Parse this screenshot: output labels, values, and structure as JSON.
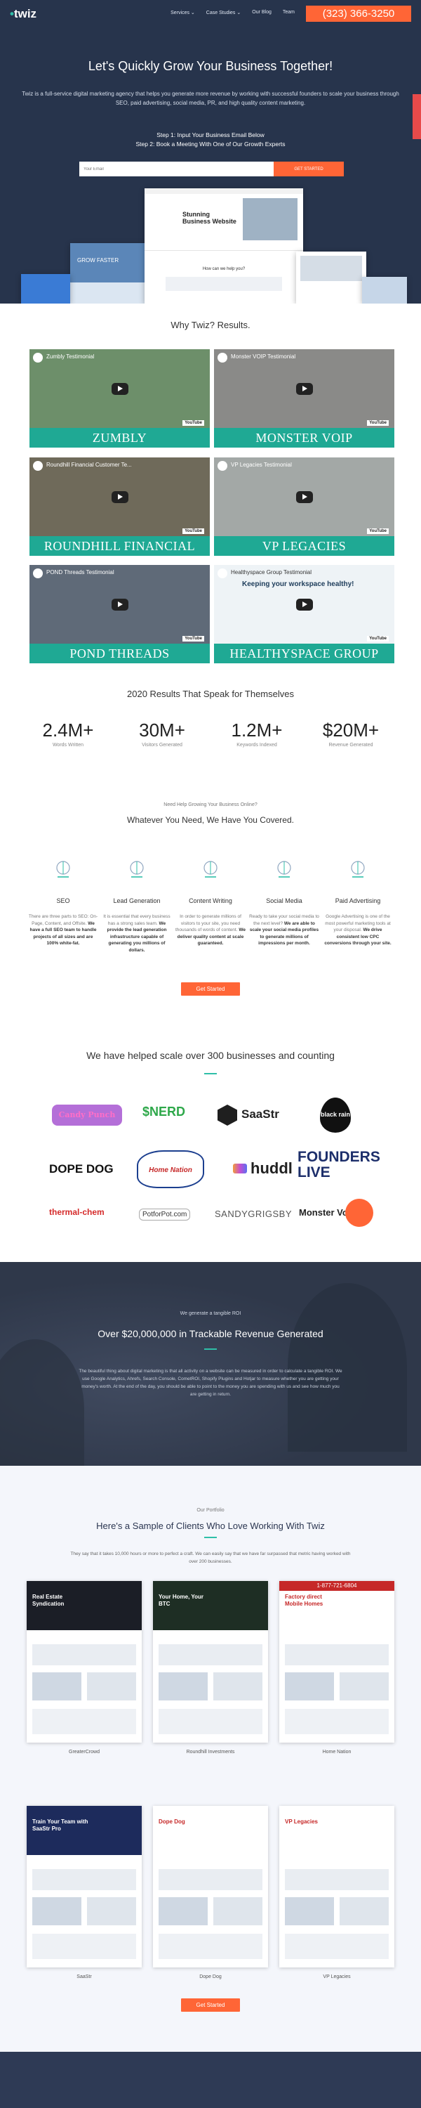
{
  "header": {
    "logo": "twiz",
    "nav": [
      "Services ⌄",
      "Case Studies ⌄",
      "Our Blog",
      "Team"
    ],
    "phone": "(323) 366-3250"
  },
  "hero": {
    "title": "Let's Quickly Grow Your Business Together!",
    "description": "Twiz is a full-service digital marketing agency that helps you generate more revenue by working with successful founders to scale your business through SEO, paid advertising, social media, PR, and high quality content marketing.",
    "step1": "Step 1: Input Your Business Email Below",
    "step2": "Step 2: Book a Meeting With One of Our Growth Experts",
    "email_placeholder": "Your Email",
    "button": "GET STARTED",
    "mock_headline": "Stunning Business Website",
    "mock_sub": "How can we help you?",
    "mock_left": "GROW FASTER"
  },
  "why": {
    "title": "Why Twiz? Results.",
    "videos": [
      {
        "title": "Zumbly Testimonial",
        "band": "ZUMBLY",
        "bg": "#6d8f6a"
      },
      {
        "title": "Monster VOIP Testimonial",
        "band": "MONSTER VOIP",
        "bg": "#8a8a88"
      },
      {
        "title": "Roundhill Financial Customer Te...",
        "band": "ROUNDHILL FINANCIAL",
        "bg": "#6f6a5a"
      },
      {
        "title": "VP Legacies Testimonial",
        "band": "VP LEGACIES",
        "bg": "#a3a8a6"
      },
      {
        "title": "POND Threads Testimonial",
        "band": "POND THREADS",
        "bg": "#5f6a78"
      },
      {
        "title": "Healthyspace Group Testimonial",
        "band": "HEALTHYSPACE GROUP",
        "bg": "#eef3f6"
      }
    ],
    "youtube": "YouTube",
    "healthy_banner": "Keeping your workspace healthy!"
  },
  "results": {
    "title": "2020 Results That Speak for Themselves",
    "stats": [
      {
        "num": "2.4M+",
        "label": "Words Written"
      },
      {
        "num": "30M+",
        "label": "Visitors Generated"
      },
      {
        "num": "1.2M+",
        "label": "Keywords Indexed"
      },
      {
        "num": "$20M+",
        "label": "Revenue Generated"
      }
    ]
  },
  "services": {
    "eyebrow": "Need Help Growing Your Business Online?",
    "title": "Whatever You Need, We Have You Covered.",
    "items": [
      {
        "name": "SEO",
        "desc": "There are three parts to SEO: On-Page, Content, and Offsite.",
        "bold": "We have a full SEO team to handle projects of all sizes and are 100% white-fat."
      },
      {
        "name": "Lead Generation",
        "desc": "It is essential that every business has a strong sales team.",
        "bold": "We provide the lead generation infrastructure capable of generating you millions of dollars."
      },
      {
        "name": "Content Writing",
        "desc": "In order to generate millions of visitors to your site, you need thousands of words of content.",
        "bold": "We deliver quality content at scale guaranteed."
      },
      {
        "name": "Social Media",
        "desc": "Ready to take your social media to the next level?",
        "bold": "We are able to scale your social media profiles to generate millions of impressions per month."
      },
      {
        "name": "Paid Advertising",
        "desc": "Google Advertising is one of the most powerful marketing tools at your disposal.",
        "bold": "We drive consistent low CPC conversions through your site."
      }
    ],
    "button": "Get Started"
  },
  "clients": {
    "title": "We have helped scale over 300 businesses and counting",
    "logos": [
      "Candy Punch",
      "$NERD",
      "SaaStr",
      "black rain",
      "DOPE DOG",
      "Home Nation",
      "huddl",
      "FOUNDERS LIVE",
      "thermal-chem",
      "PotforPot.com",
      "SANDYGRIGSBY",
      "Monster VoIP"
    ]
  },
  "revenue": {
    "eyebrow": "We generate a tangible ROI",
    "title": "Over $20,000,000 in Trackable Revenue Generated",
    "body": "The beautiful thing about digital marketing is that all activity on a website can be measured in order to calculate a tangible ROI. We use Google Analytics, Ahrefs, Search Console, CometROI, Shopify Plugins and Hotjar to measure whether you are getting your money's worth. At the end of the day, you should be able to point to the money you are spending with us and see how much you are getting in return."
  },
  "portfolio": {
    "eyebrow": "Our Portfolio",
    "title": "Here's a Sample of Clients Who Love Working With Twiz",
    "body": "They say that it takes 10,000 hours or more to perfect a craft. We can easily say that we have far surpassed that metric having worked with over 200 businesses.",
    "items": [
      {
        "caption": "GreaterCrowd",
        "hero": "Real Estate Syndication"
      },
      {
        "caption": "Roundhill Investments",
        "hero": "Your Home, Your BTC"
      },
      {
        "caption": "Home Nation",
        "hero": "Factory direct Mobile Homes"
      },
      {
        "caption": "SaaStr",
        "hero": "Train Your Team with SaaStr Pro"
      },
      {
        "caption": "Dope Dog",
        "hero": "Dope Dog"
      },
      {
        "caption": "VP Legacies",
        "hero": "VP Legacies"
      }
    ],
    "phone_banner": "1-877-721-6804",
    "button": "Get Started"
  },
  "colors": {
    "navy": "#27344c",
    "accent": "#ff6536",
    "teal": "#1fa994"
  }
}
